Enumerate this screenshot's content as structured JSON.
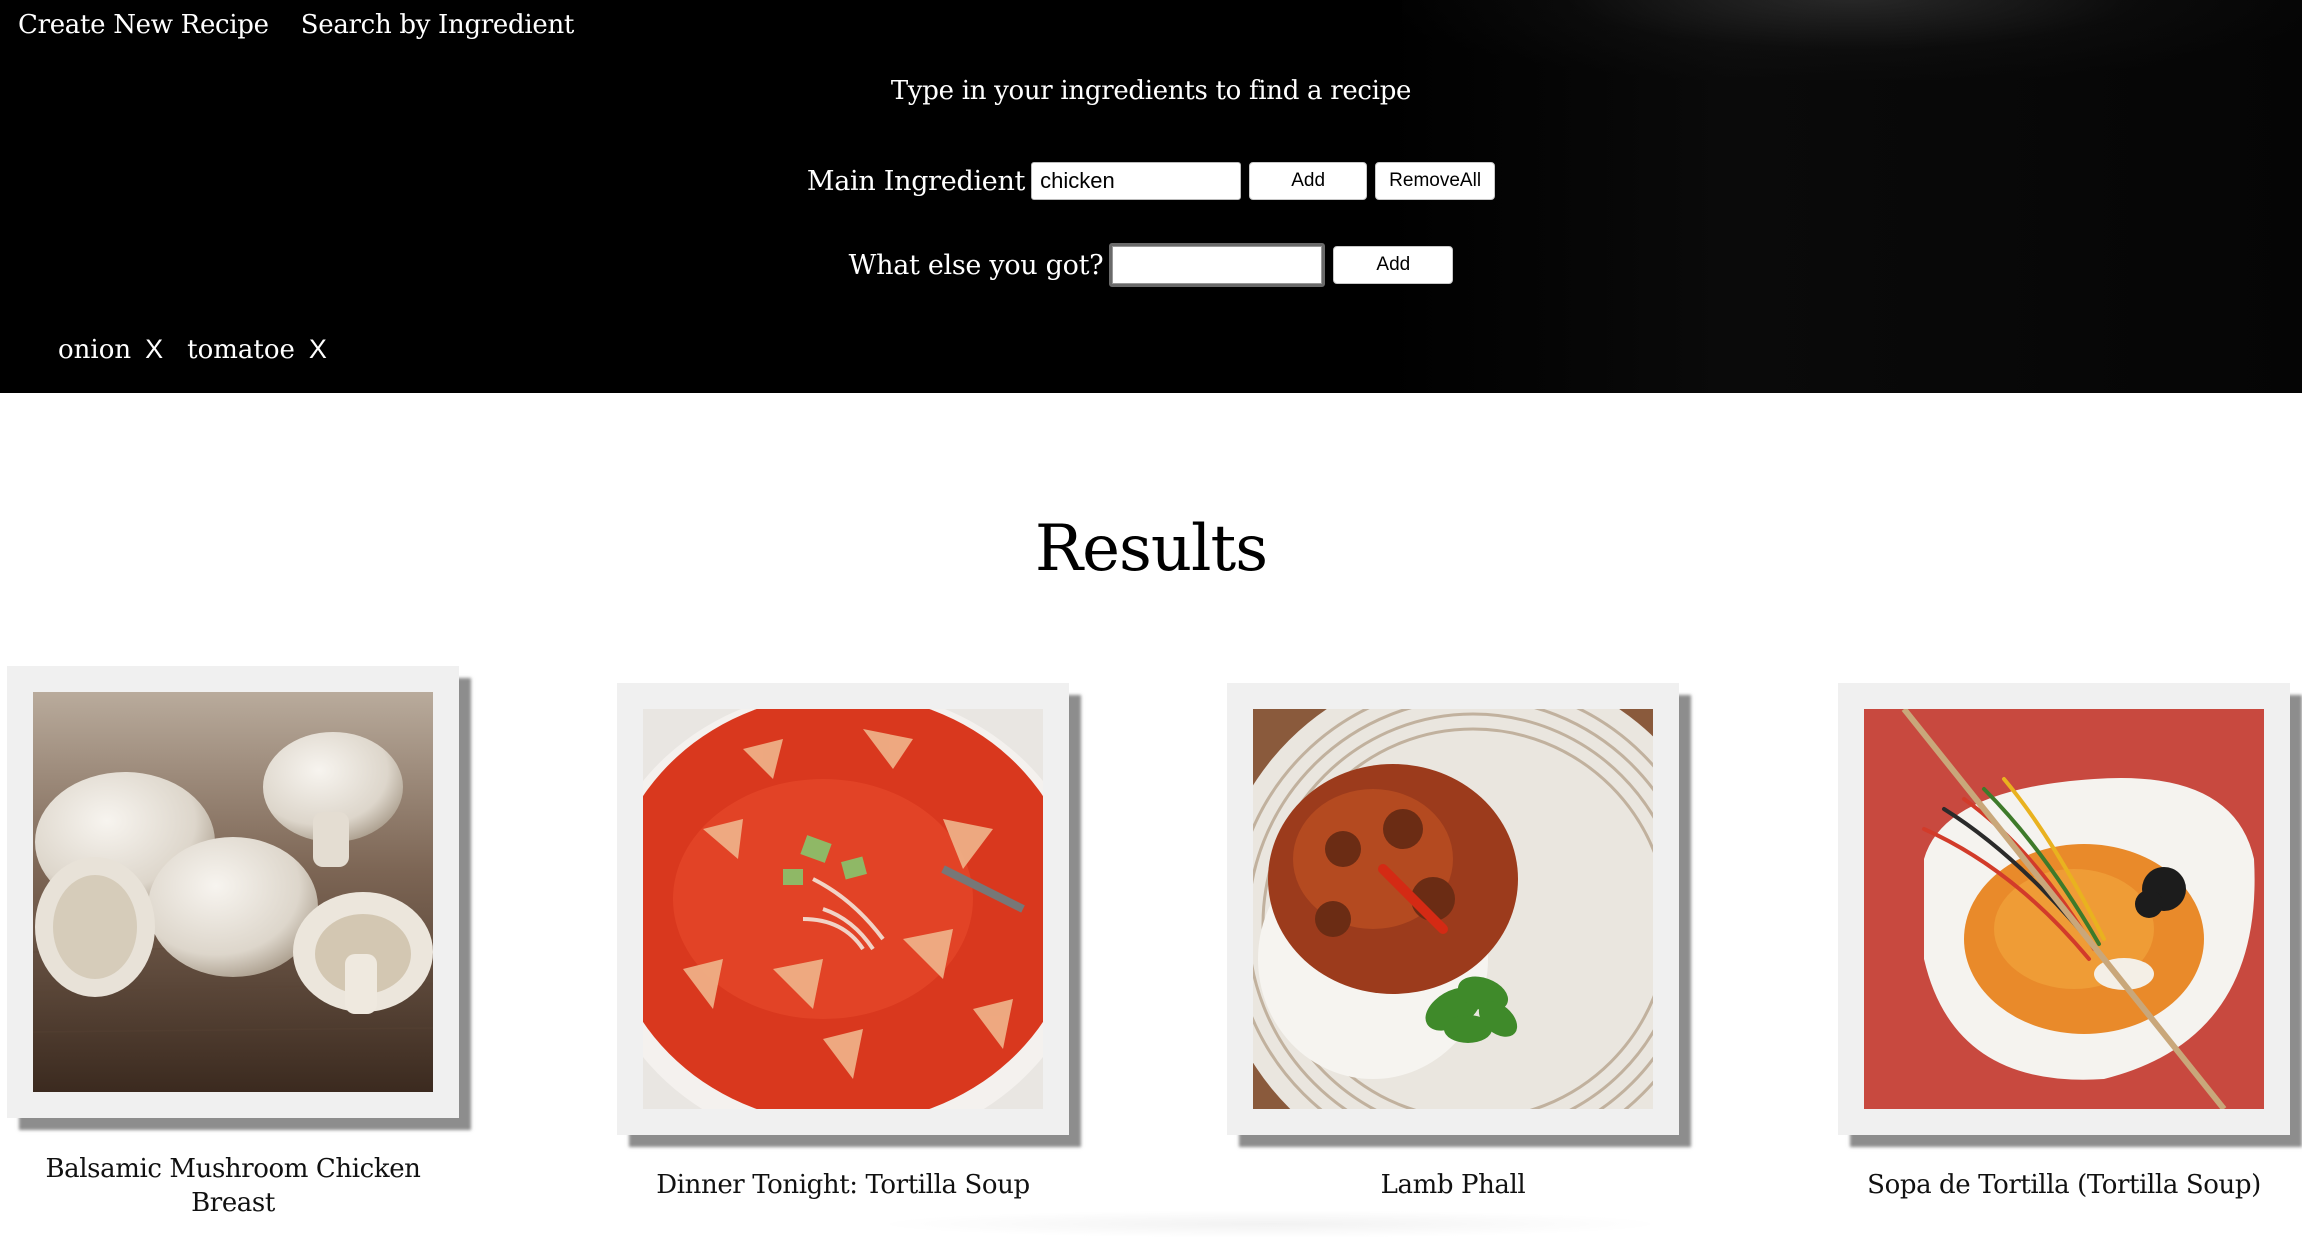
{
  "nav": {
    "create_label": "Create New Recipe",
    "search_label": "Search by Ingredient"
  },
  "prompt": "Type in your ingredients to find a recipe",
  "main_ingredient": {
    "label": "Main Ingredient",
    "value": "chicken",
    "add_label": "Add",
    "remove_all_label": "RemoveAll"
  },
  "other_ingredient": {
    "label": "What else you got?",
    "value": "",
    "add_label": "Add"
  },
  "tags": [
    {
      "name": "onion",
      "remove": "X"
    },
    {
      "name": "tomatoe",
      "remove": "X"
    }
  ],
  "results": {
    "title": "Results",
    "items": [
      {
        "title": "Balsamic Mushroom Chicken Breast",
        "image": "mushrooms-photo"
      },
      {
        "title": "Dinner Tonight: Tortilla Soup",
        "image": "tortilla-soup-photo"
      },
      {
        "title": "Lamb Phall",
        "image": "lamb-curry-photo"
      },
      {
        "title": "Sopa de Tortilla (Tortilla Soup)",
        "image": "sopa-de-tortilla-photo"
      }
    ]
  },
  "colors": {
    "header_bg": "#000000",
    "page_bg": "#ffffff",
    "frame_bg": "#f0f0f0"
  }
}
